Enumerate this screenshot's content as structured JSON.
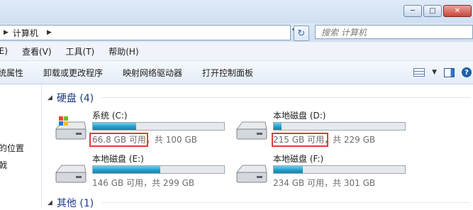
{
  "breadcrumb": {
    "location": "计算机"
  },
  "search": {
    "placeholder": "搜索 计算机"
  },
  "menu": [
    "查看(V)",
    "工具(T)",
    "帮助(H)"
  ],
  "menu_first": "(E)",
  "commands": [
    "统属性",
    "卸载或更改程序",
    "映射网络驱动器",
    "打开控制面板"
  ],
  "left_pane": {
    "item1": "的位置",
    "item2": "戟"
  },
  "groups": {
    "hard_disks": {
      "title": "硬盘 (4)"
    },
    "other": {
      "title": "其他 (1)"
    }
  },
  "drives": [
    {
      "name": "系统 (C:)",
      "free": "66.8 GB 可用",
      "sep": "，",
      "total": "共 100 GB",
      "used_fraction": 0.332,
      "system": true,
      "highlight": true
    },
    {
      "name": "本地磁盘 (D:)",
      "free": "215 GB 可用",
      "sep": "，",
      "total": "共 229 GB",
      "used_fraction": 0.061,
      "system": false,
      "highlight": true
    },
    {
      "name": "本地磁盘 (E:)",
      "free": "146 GB 可用",
      "sep": "，",
      "total": "共 299 GB",
      "used_fraction": 0.512,
      "system": false,
      "highlight": false
    },
    {
      "name": "本地磁盘 (F:)",
      "free": "234 GB 可用",
      "sep": "，",
      "total": "共 301 GB",
      "used_fraction": 0.223,
      "system": false,
      "highlight": false
    }
  ],
  "colors": {
    "highlight": "#e23b3b",
    "bar_fill": "#1e9bc7",
    "header_text": "#1d3b80"
  }
}
